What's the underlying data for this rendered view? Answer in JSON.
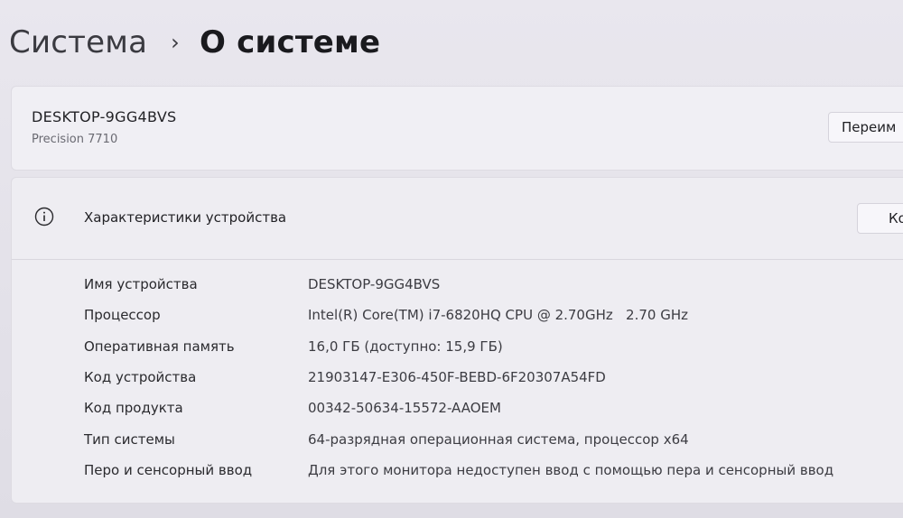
{
  "breadcrumb": {
    "parent": "Система",
    "separator": "›",
    "current": "О системе"
  },
  "device_card": {
    "name": "DESKTOP-9GG4BVS",
    "model": "Precision 7710",
    "rename_button": "Переим"
  },
  "specs": {
    "title": "Характеристики устройства",
    "copy_button": "Ко",
    "icon": "info-icon",
    "rows": [
      {
        "label": "Имя устройства",
        "value": "DESKTOP-9GG4BVS"
      },
      {
        "label": "Процессор",
        "value": "Intel(R) Core(TM) i7-6820HQ CPU @ 2.70GHz   2.70 GHz"
      },
      {
        "label": "Оперативная память",
        "value": "16,0 ГБ (доступно: 15,9 ГБ)"
      },
      {
        "label": "Код устройства",
        "value": "21903147-E306-450F-BEBD-6F20307A54FD"
      },
      {
        "label": "Код продукта",
        "value": "00342-50634-15572-AAOEM"
      },
      {
        "label": "Тип системы",
        "value": "64-разрядная операционная система, процессор x64"
      },
      {
        "label": "Перо и сенсорный ввод",
        "value": "Для этого монитора недоступен ввод с помощью пера и сенсорный ввод"
      }
    ]
  },
  "colors": {
    "background": "#e6e4ec",
    "card": "#f0eff4",
    "text": "#1c1c1f"
  }
}
